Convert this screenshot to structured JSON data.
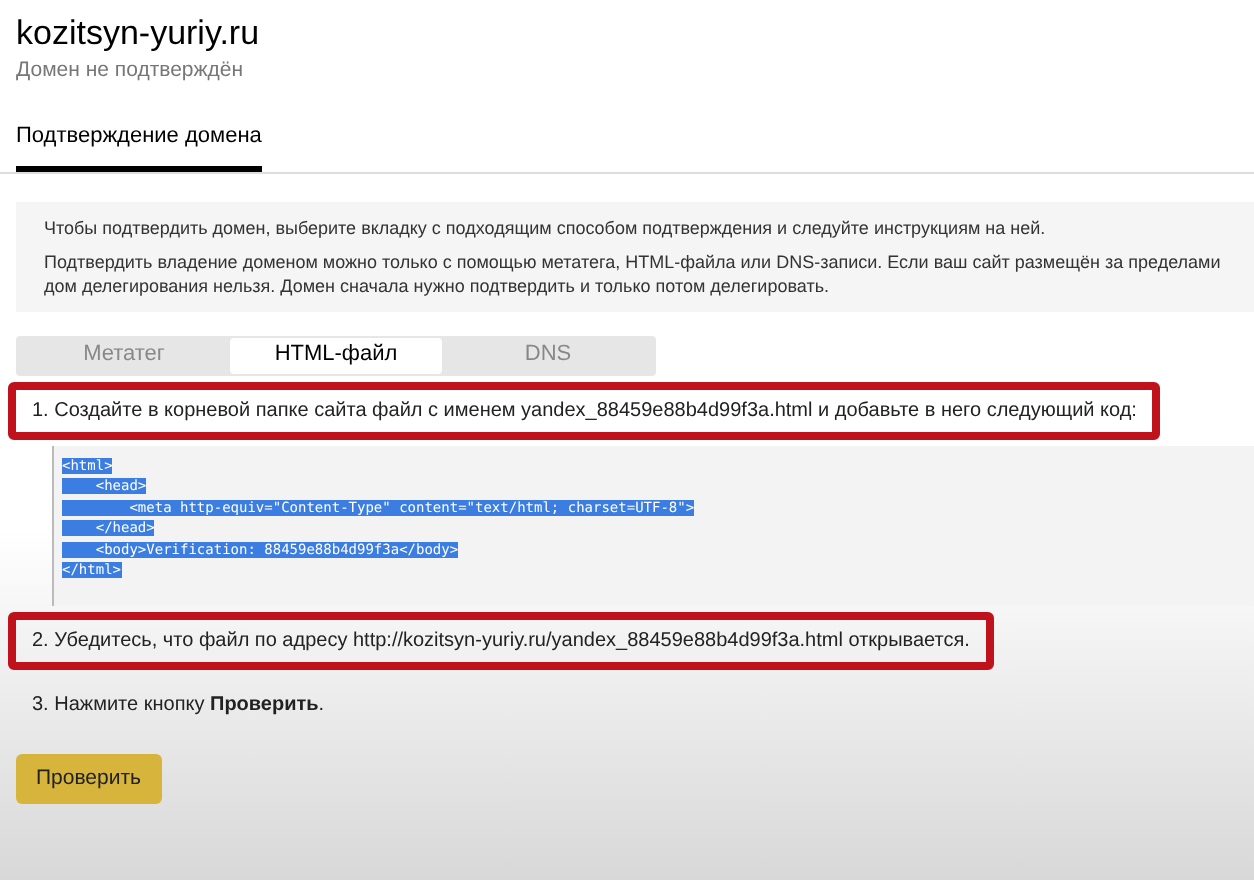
{
  "header": {
    "title": "kozitsyn-yuriy.ru",
    "subtitle": "Домен не подтверждён"
  },
  "page_tabs": [
    {
      "label": "Подтверждение домена",
      "selected": true
    }
  ],
  "info": [
    "Чтобы подтвердить домен, выберите вкладку с подходящим способом подтверждения и следуйте инструкциям на ней.",
    "Подтвердить владение доменом можно только с помощью метатега, HTML-файла или DNS-записи. Если ваш сайт размещён за пределами дом делегирования нельзя. Домен сначала нужно подтвердить и только потом делегировать."
  ],
  "method_tabs": [
    {
      "label": "Метатег",
      "selected": false
    },
    {
      "label": "HTML-файл",
      "selected": true
    },
    {
      "label": "DNS",
      "selected": false
    }
  ],
  "steps": [
    {
      "kind": "text",
      "text": "1. Создайте в корневой папке сайта файл с именем yandex_88459e88b4d99f3a.html и добавьте в него следующий код:",
      "highlighted": true
    },
    {
      "kind": "code",
      "selected": true,
      "lines": [
        "<html>",
        "    <head>",
        "        <meta http-equiv=\"Content-Type\" content=\"text/html; charset=UTF-8\">",
        "    </head>",
        "    <body>Verification: 88459e88b4d99f3a</body>",
        "</html>"
      ]
    },
    {
      "kind": "text",
      "text": "2. Убедитесь, что файл по адресу http://kozitsyn-yuriy.ru/yandex_88459e88b4d99f3a.html открывается.",
      "highlighted": true
    },
    {
      "kind": "text",
      "text": "3. Нажмите кнопку **Проверить**.",
      "highlighted": false
    }
  ],
  "button": "Проверить"
}
